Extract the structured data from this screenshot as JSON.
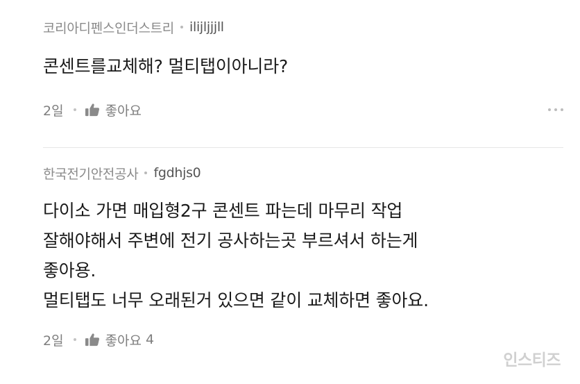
{
  "comments": [
    {
      "company": "코리아디펜스인더스트리",
      "nickname": "ilijljjjll",
      "lines": [
        "콘센트를교체해? 멀티탭이아니라?"
      ],
      "time": "2일",
      "like_label": "좋아요",
      "like_count": ""
    },
    {
      "company": "한국전기안전공사",
      "nickname": "fgdhjs0",
      "lines": [
        "다이소 가면 매입형2구 콘센트 파는데 마무리 작업",
        "잘해야해서 주변에 전기 공사하는곳 부르셔서 하는게",
        "좋아용.",
        "멀티탭도 너무 오래된거 있으면 같이 교체하면 좋아요."
      ],
      "time": "2일",
      "like_label": "좋아요",
      "like_count": "4"
    }
  ],
  "icons": {
    "like": "thumbs-up-icon",
    "more": "more-horizontal-icon"
  },
  "watermark": "인스티즈",
  "colors": {
    "text": "#1a1a1a",
    "meta": "#7d7d7d",
    "divider": "#e6e6e6"
  }
}
